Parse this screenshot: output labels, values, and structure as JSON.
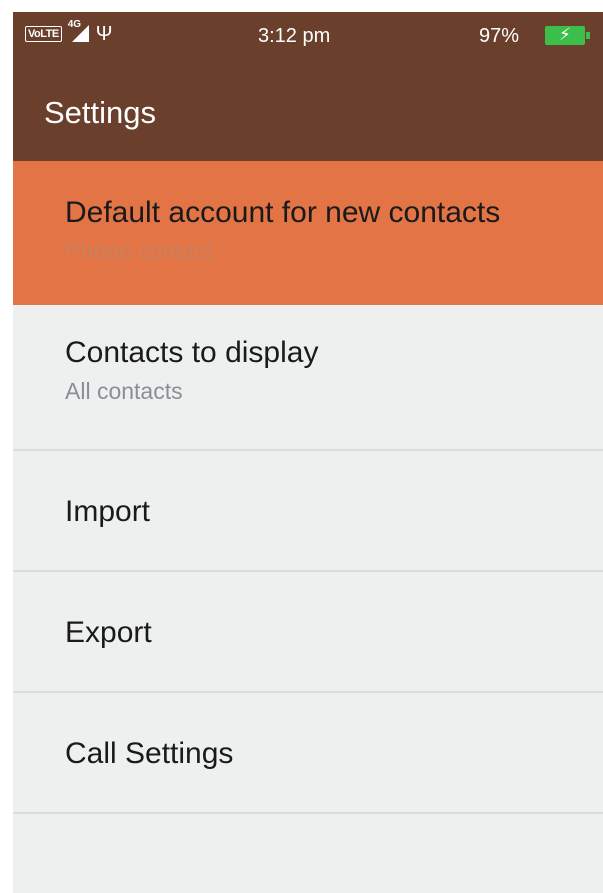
{
  "status_bar": {
    "volte_label": "VoLTE",
    "network_type": "4G",
    "usb_icon": "usb-icon",
    "time": "3:12 pm",
    "battery_percent": "97%",
    "battery_icon": "battery-charging-icon",
    "battery_level": 0.97
  },
  "header": {
    "title": "Settings"
  },
  "colors": {
    "header_bg": "#6a3f2c",
    "selected_bg": "#e27446",
    "list_bg": "#eef0f0",
    "battery": "#3cbf4a"
  },
  "settings": {
    "items": [
      {
        "title": "Default account for new contacts",
        "subtitle": "Phone contact",
        "selected": true
      },
      {
        "title": "Contacts to display",
        "subtitle": "All contacts",
        "selected": false
      },
      {
        "title": "Import",
        "selected": false
      },
      {
        "title": "Export",
        "selected": false
      },
      {
        "title": "Call Settings",
        "selected": false
      }
    ]
  }
}
